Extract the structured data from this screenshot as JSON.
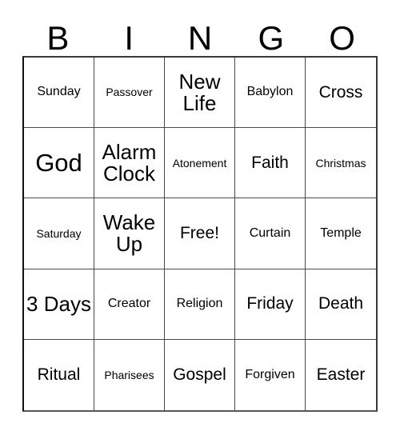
{
  "card": {
    "header_letters": [
      "B",
      "I",
      "N",
      "G",
      "O"
    ],
    "free_space_label": "Free!",
    "columns": 5,
    "rows": 5,
    "border_color": "#000000",
    "background_color": "#ffffff",
    "text_color": "#000000",
    "cells": [
      [
        {
          "label": "Sunday",
          "size": "sm"
        },
        {
          "label": "Passover",
          "size": "xs"
        },
        {
          "label": "New Life",
          "size": "lg"
        },
        {
          "label": "Babylon",
          "size": "sm"
        },
        {
          "label": "Cross",
          "size": "md"
        }
      ],
      [
        {
          "label": "God",
          "size": "xl"
        },
        {
          "label": "Alarm Clock",
          "size": "lg"
        },
        {
          "label": "Atonement",
          "size": "xs"
        },
        {
          "label": "Faith",
          "size": "md"
        },
        {
          "label": "Christmas",
          "size": "xs"
        }
      ],
      [
        {
          "label": "Saturday",
          "size": "xs"
        },
        {
          "label": "Wake Up",
          "size": "lg"
        },
        {
          "label": "Free!",
          "size": "md"
        },
        {
          "label": "Curtain",
          "size": "sm"
        },
        {
          "label": "Temple",
          "size": "sm"
        }
      ],
      [
        {
          "label": "3 Days",
          "size": "lg"
        },
        {
          "label": "Creator",
          "size": "sm"
        },
        {
          "label": "Religion",
          "size": "sm"
        },
        {
          "label": "Friday",
          "size": "md"
        },
        {
          "label": "Death",
          "size": "md"
        }
      ],
      [
        {
          "label": "Ritual",
          "size": "md"
        },
        {
          "label": "Pharisees",
          "size": "xs"
        },
        {
          "label": "Gospel",
          "size": "md"
        },
        {
          "label": "Forgiven",
          "size": "sm"
        },
        {
          "label": "Easter",
          "size": "md"
        }
      ]
    ]
  }
}
